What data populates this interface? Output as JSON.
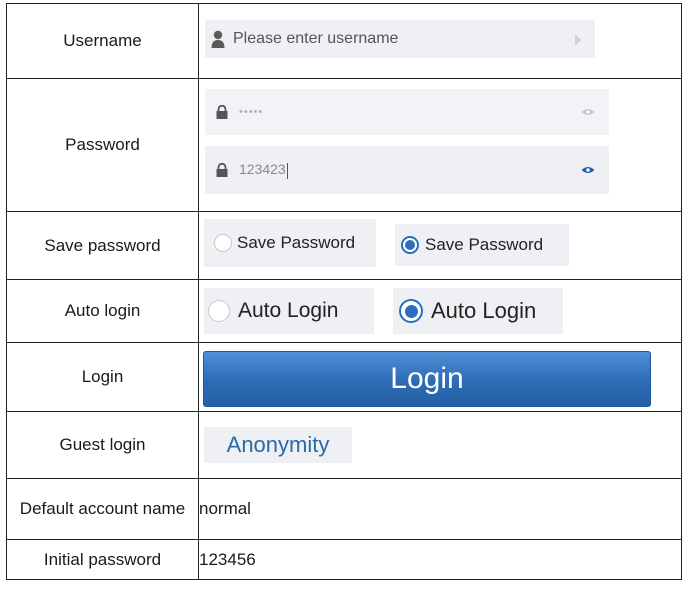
{
  "rows": {
    "username": {
      "label": "Username",
      "placeholder": "Please enter username",
      "icons": [
        "user-icon",
        "arrow-right-icon"
      ]
    },
    "password": {
      "label": "Password",
      "masked_value": "•••••",
      "revealed_value": "123423",
      "icons": [
        "lock-icon",
        "eye-icon"
      ]
    },
    "save_password": {
      "label": "Save password",
      "unchecked_text": "Save Password",
      "checked_text": "Save Password"
    },
    "auto_login": {
      "label": "Auto login",
      "unchecked_text": "Auto Login",
      "checked_text": "Auto Login"
    },
    "login": {
      "label": "Login",
      "button_text": "Login"
    },
    "guest_login": {
      "label": "Guest login",
      "button_text": "Anonymity"
    },
    "default_account": {
      "label": "Default account name",
      "value": "normal"
    },
    "initial_password": {
      "label": "Initial password",
      "value": "123456"
    }
  },
  "colors": {
    "accent": "#2a6ebf",
    "field_background": "#eef0f3",
    "link_text": "#2a6aa8",
    "border": "#222222"
  }
}
